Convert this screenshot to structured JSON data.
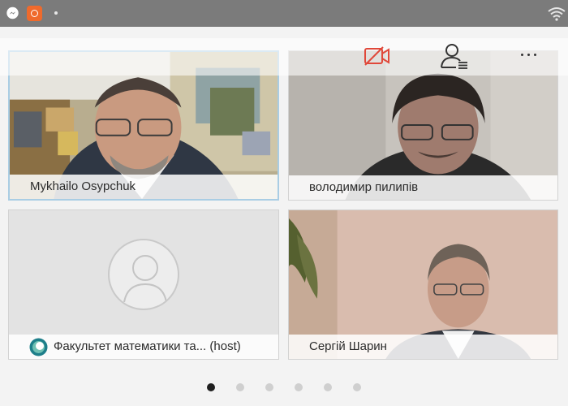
{
  "status_bar": {
    "icons": [
      "messenger-icon",
      "app-icon",
      "notification-dot",
      "wifi-icon"
    ]
  },
  "toolbar": {
    "buttons": [
      "video-off-icon",
      "participants-icon",
      "more-icon"
    ],
    "video_off_color": "#e0483a"
  },
  "participants": [
    {
      "name": "Mykhailo Osypchuk",
      "active": true
    },
    {
      "name": "володимир пилипів",
      "active": false
    },
    {
      "name": "Факультет математики та... (host)",
      "active": false,
      "no_video": true
    },
    {
      "name": "Сергій Шарин",
      "active": false
    }
  ],
  "pagination": {
    "pages": 6,
    "current": 1
  }
}
